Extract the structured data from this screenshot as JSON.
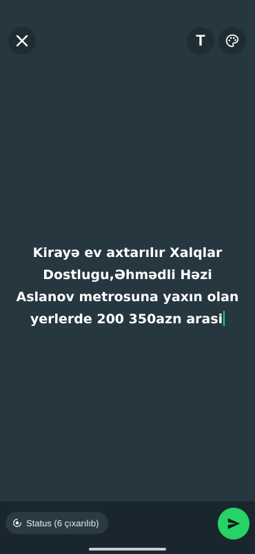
{
  "composer": {
    "status_text": "Kirayə ev axtarılır Xalqlar\nDostlugu,Əhmədli Həzi\nAslanov metrosuna yaxın olan\nyerlerde 200 350azn arasi",
    "background_color": "#263740",
    "caret_color": "#25d366"
  },
  "toolbar": {
    "close_icon": "close-icon",
    "text_tool_label": "T",
    "text_tool_icon": "text-tool-icon",
    "palette_icon": "palette-icon"
  },
  "footer": {
    "privacy_label": "Status (6 çıxarılıb)",
    "privacy_icon": "status-privacy-icon",
    "send_icon": "send-icon",
    "accent_color": "#25d366"
  }
}
